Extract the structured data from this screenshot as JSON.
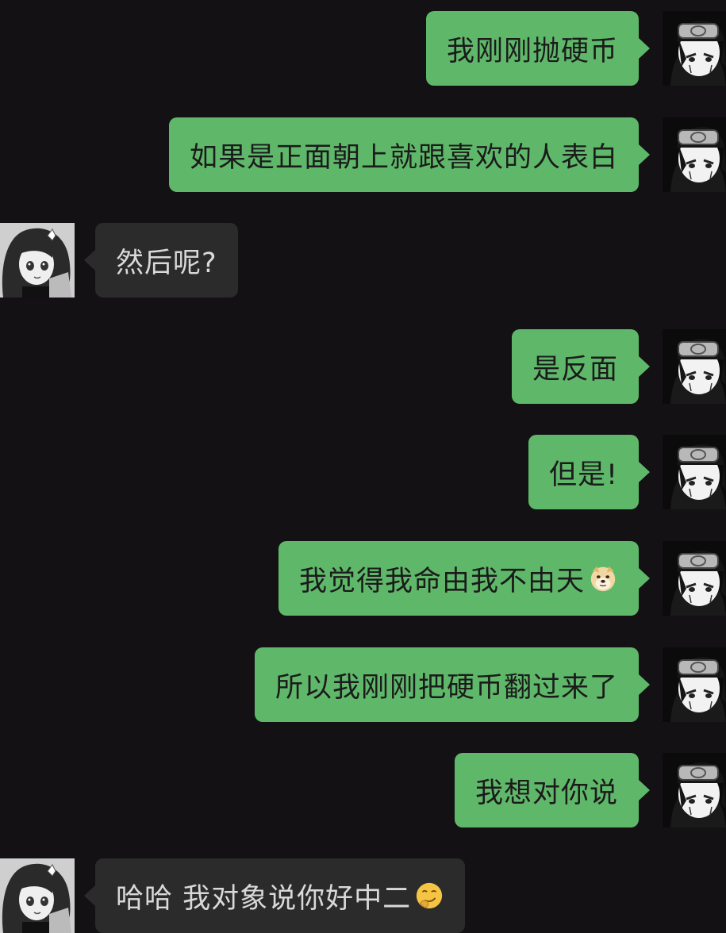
{
  "messages": [
    {
      "side": "right",
      "text": "我刚刚抛硬币"
    },
    {
      "side": "right",
      "text": "如果是正面朝上就跟喜欢的人表白"
    },
    {
      "side": "left",
      "text": "然后呢?"
    },
    {
      "side": "right",
      "text": "是反面"
    },
    {
      "side": "right",
      "text": "但是!"
    },
    {
      "side": "right",
      "text": "我觉得我命由我不由天",
      "emoji": "doge-emoji"
    },
    {
      "side": "right",
      "text": "所以我刚刚把硬币翻过来了"
    },
    {
      "side": "right",
      "text": "我想对你说"
    },
    {
      "side": "left",
      "text": "哈哈 我对象说你好中二",
      "emoji": "smirk-emoji"
    }
  ],
  "avatars": {
    "me": "ninja-avatar",
    "other": "anime-girl-avatar"
  },
  "colors": {
    "background": "#131114",
    "my_bubble": "#5fb86a",
    "their_bubble": "#2b2b2b"
  }
}
